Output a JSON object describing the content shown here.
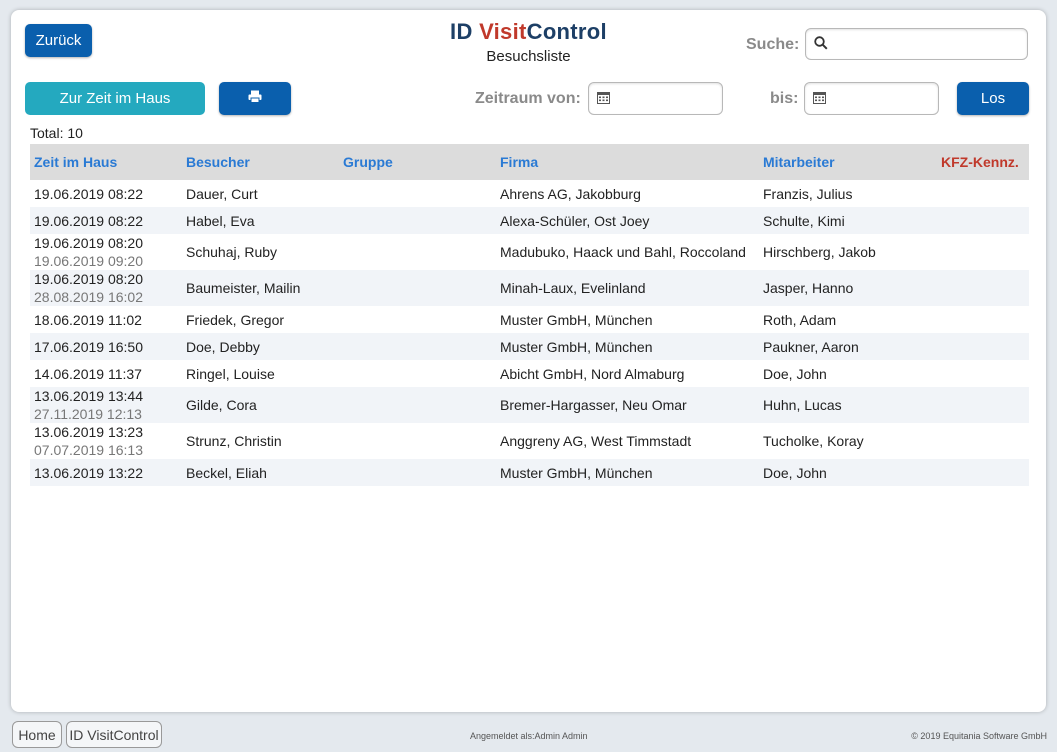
{
  "header": {
    "back_label": "Zurück",
    "logo_id": "ID ",
    "logo_visit": "Visit",
    "logo_control": "Control",
    "subtitle": "Besuchsliste",
    "search_label": "Suche:",
    "search_value": "",
    "search_icon": "magnifier-icon"
  },
  "toolbar": {
    "time_in_house_label": "Zur Zeit im Haus",
    "print_icon": "printer-icon",
    "period_from_label": "Zeitraum von:",
    "period_to_label": "bis:",
    "go_label": "Los",
    "calendar_icon": "calendar-icon"
  },
  "total": "Total: 10",
  "table": {
    "columns": [
      "Zeit im Haus",
      "Besucher",
      "Gruppe",
      "Firma",
      "Mitarbeiter",
      "KFZ-Kennz."
    ],
    "rows": [
      {
        "t1": "19.06.2019 08:22",
        "t2": "",
        "visitor": "Dauer, Curt",
        "group": "",
        "company": "Ahrens AG, Jakobburg",
        "employee": "Franzis, Julius",
        "kfz": ""
      },
      {
        "t1": "19.06.2019 08:22",
        "t2": "",
        "visitor": "Habel, Eva",
        "group": "",
        "company": "Alexa-Schüler, Ost Joey",
        "employee": "Schulte, Kimi",
        "kfz": ""
      },
      {
        "t1": "19.06.2019 08:20",
        "t2": "19.06.2019 09:20",
        "visitor": "Schuhaj, Ruby",
        "group": "",
        "company": "Madubuko, Haack und Bahl, Roccoland",
        "employee": "Hirschberg, Jakob",
        "kfz": ""
      },
      {
        "t1": "19.06.2019 08:20",
        "t2": "28.08.2019 16:02",
        "visitor": "Baumeister, Mailin",
        "group": "",
        "company": "Minah-Laux, Evelinland",
        "employee": "Jasper, Hanno",
        "kfz": ""
      },
      {
        "t1": "18.06.2019 11:02",
        "t2": "",
        "visitor": "Friedek, Gregor",
        "group": "",
        "company": "Muster GmbH, München",
        "employee": "Roth, Adam",
        "kfz": ""
      },
      {
        "t1": "17.06.2019 16:50",
        "t2": "",
        "visitor": "Doe, Debby",
        "group": "",
        "company": "Muster GmbH, München",
        "employee": "Paukner, Aaron",
        "kfz": ""
      },
      {
        "t1": "14.06.2019 11:37",
        "t2": "",
        "visitor": "Ringel, Louise",
        "group": "",
        "company": "Abicht GmbH, Nord Almaburg",
        "employee": "Doe, John",
        "kfz": ""
      },
      {
        "t1": "13.06.2019 13:44",
        "t2": "27.11.2019 12:13",
        "visitor": "Gilde, Cora",
        "group": "",
        "company": "Bremer-Hargasser, Neu Omar",
        "employee": "Huhn, Lucas",
        "kfz": ""
      },
      {
        "t1": "13.06.2019 13:23",
        "t2": "07.07.2019 16:13",
        "visitor": "Strunz, Christin",
        "group": "",
        "company": "Anggreny AG, West Timmstadt",
        "employee": "Tucholke, Koray",
        "kfz": ""
      },
      {
        "t1": "13.06.2019 13:22",
        "t2": "",
        "visitor": "Beckel, Eliah",
        "group": "",
        "company": "Muster GmbH, München",
        "employee": "Doe, John",
        "kfz": ""
      }
    ]
  },
  "footer": {
    "home_label": "Home",
    "app_label": "ID VisitControl",
    "logged_in": "Angemeldet als:Admin Admin",
    "copyright": "© 2019 Equitania Software GmbH"
  },
  "colors": {
    "primary": "#0a5fad",
    "teal": "#24a9bf",
    "header_link": "#2a7ad4",
    "accent_red": "#c0392b"
  }
}
